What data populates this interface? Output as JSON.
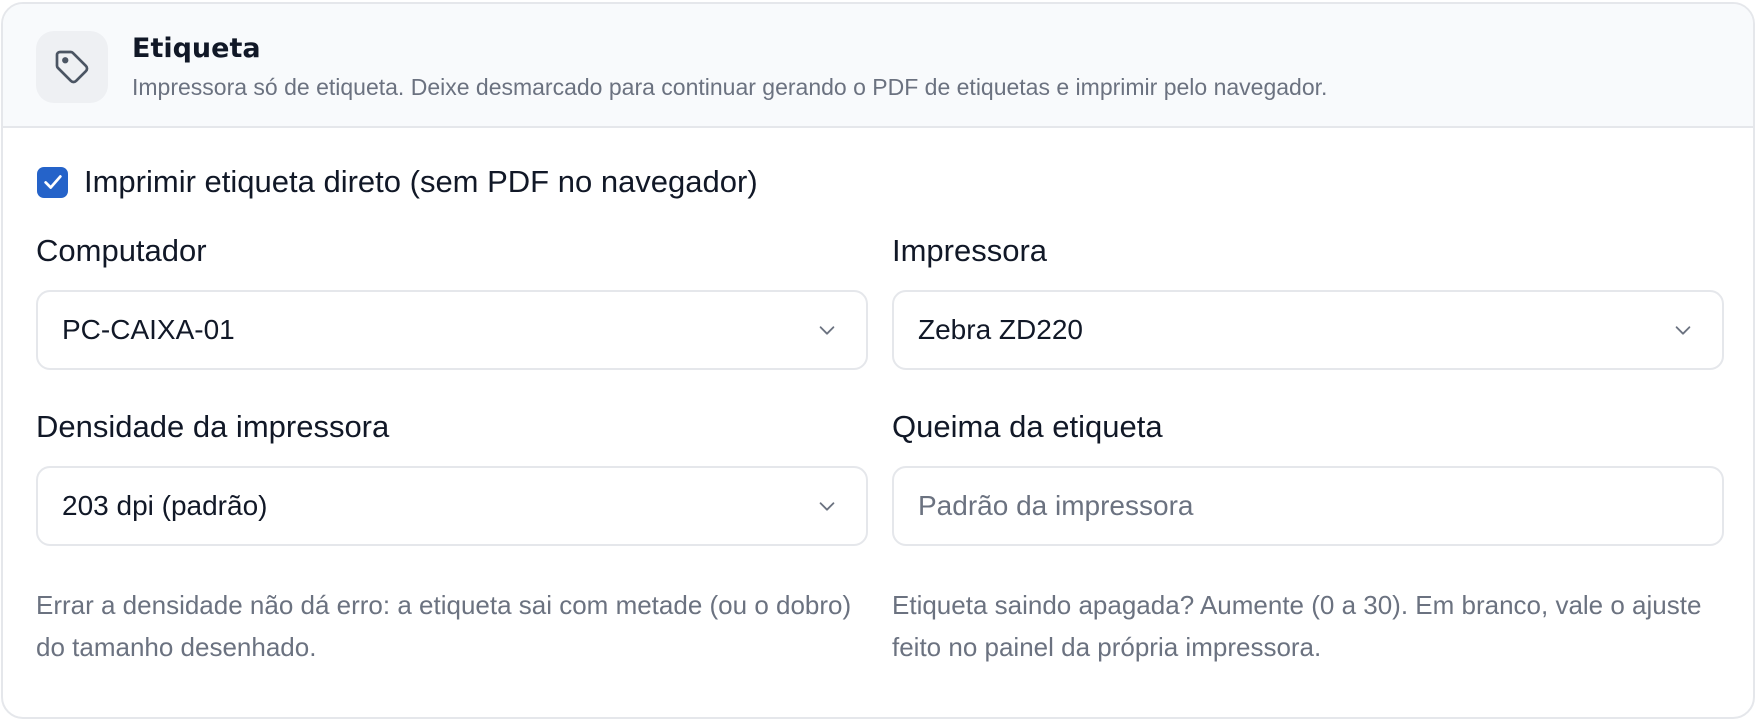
{
  "header": {
    "icon": "tag-icon",
    "title": "Etiqueta",
    "description": "Impressora só de etiqueta. Deixe desmarcado para continuar gerando o PDF de etiquetas e imprimir pelo navegador."
  },
  "direct_print": {
    "checked": true,
    "label": "Imprimir etiqueta direto (sem PDF no navegador)"
  },
  "fields": {
    "computer": {
      "label": "Computador",
      "value": "PC-CAIXA-01"
    },
    "printer": {
      "label": "Impressora",
      "value": "Zebra ZD220"
    },
    "density": {
      "label": "Densidade da impressora",
      "value": "203 dpi (padrão)",
      "help": "Errar a densidade não dá erro: a etiqueta sai com metade (ou o dobro) do tamanho desenhado."
    },
    "darkness": {
      "label": "Queima da etiqueta",
      "value": "",
      "placeholder": "Padrão da impressora",
      "help": "Etiqueta saindo apagada? Aumente (0 a 30). Em branco, vale o ajuste feito no painel da própria impressora."
    }
  },
  "colors": {
    "accent": "#2563c9",
    "border": "#e5e7eb",
    "header_bg": "#f8fafc",
    "muted_text": "#6b7280"
  }
}
